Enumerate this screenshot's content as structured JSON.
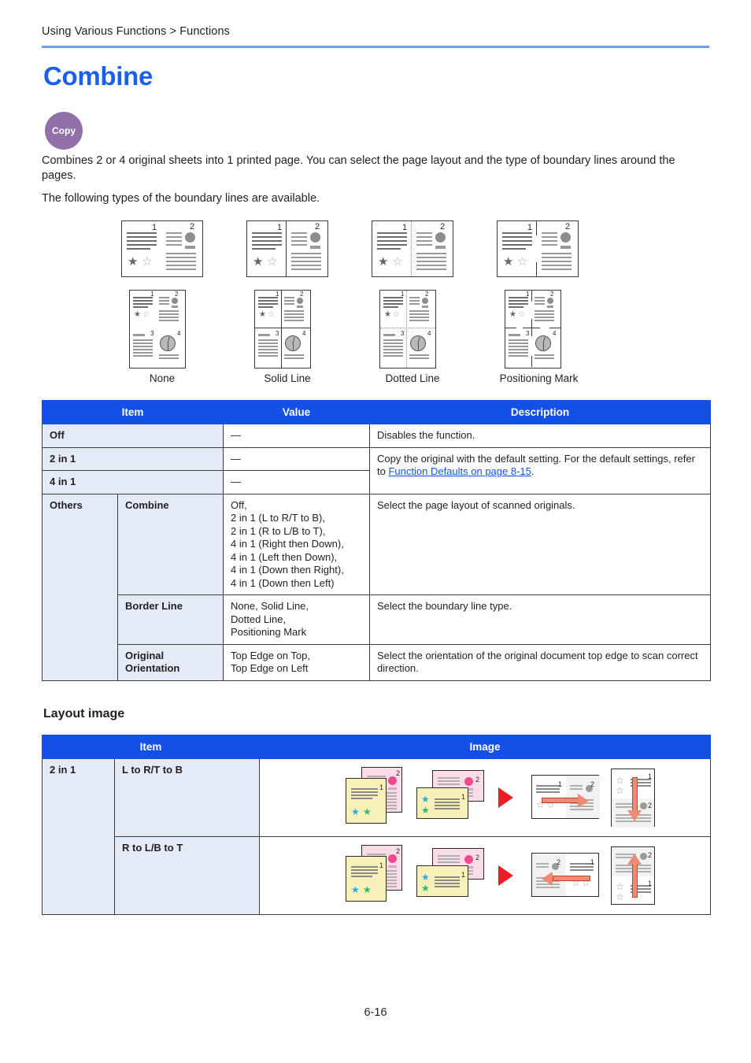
{
  "header": {
    "breadcrumb": "Using Various Functions > Functions",
    "title": "Combine",
    "badge": "Copy"
  },
  "intro": {
    "paragraph1": "Combines 2 or 4 original sheets into 1 printed page. You can select the page layout and the type of boundary lines around the pages.",
    "paragraph2": "The following types of the boundary lines are available."
  },
  "diagram": {
    "labels": [
      "None",
      "Solid Line",
      "Dotted Line",
      "Positioning Mark"
    ],
    "page_numbers_2in1": [
      "1",
      "2"
    ],
    "page_numbers_4in1": [
      "1",
      "2",
      "3",
      "4"
    ]
  },
  "main_table": {
    "headers": [
      "Item",
      "Value",
      "Description"
    ],
    "rows": [
      {
        "item": "Off",
        "value": "—",
        "description": "Disables the function."
      },
      {
        "item": "2 in 1",
        "value": "—",
        "description_pre": "Copy the original with the default setting. For the default settings, refer to ",
        "description_link": "Function Defaults on page 8-15",
        "description_post": "."
      },
      {
        "item": "4 in 1",
        "value": "—"
      }
    ],
    "others_label": "Others",
    "others_rows": [
      {
        "sub_item": "Combine",
        "value": "Off,\n2 in 1 (L to R/T to B),\n2 in 1 (R to L/B to T),\n4 in 1 (Right then Down),\n4 in 1 (Left then Down),\n4 in 1 (Down then Right),\n4 in 1 (Down then Left)",
        "description": "Select the page layout of scanned originals."
      },
      {
        "sub_item": "Border Line",
        "value": "None, Solid Line,\nDotted Line,\nPositioning Mark",
        "description": "Select the boundary line type."
      },
      {
        "sub_item": "Original Orientation",
        "value": "Top Edge on Top,\nTop Edge on Left",
        "description": "Select the orientation of the original document top edge to scan correct direction."
      }
    ]
  },
  "layout_section": {
    "heading": "Layout image",
    "headers": [
      "Item",
      "Image"
    ],
    "rows": [
      {
        "item": "2 in 1",
        "sub_item": "L to R/T to B"
      },
      {
        "item": "",
        "sub_item": "R to L/B to T"
      }
    ]
  },
  "footer": {
    "page_number": "6-16"
  },
  "colors": {
    "title_blue": "#1b5ff0",
    "table_header_blue": "#1450e8",
    "row_shade": "#e4ebf7",
    "badge_purple": "#9171a8",
    "link_blue": "#1450e8",
    "rule_blue": "#6f9fe0",
    "arrow_red": "#ed1c24",
    "arrow_salmon": "#f08a72"
  }
}
